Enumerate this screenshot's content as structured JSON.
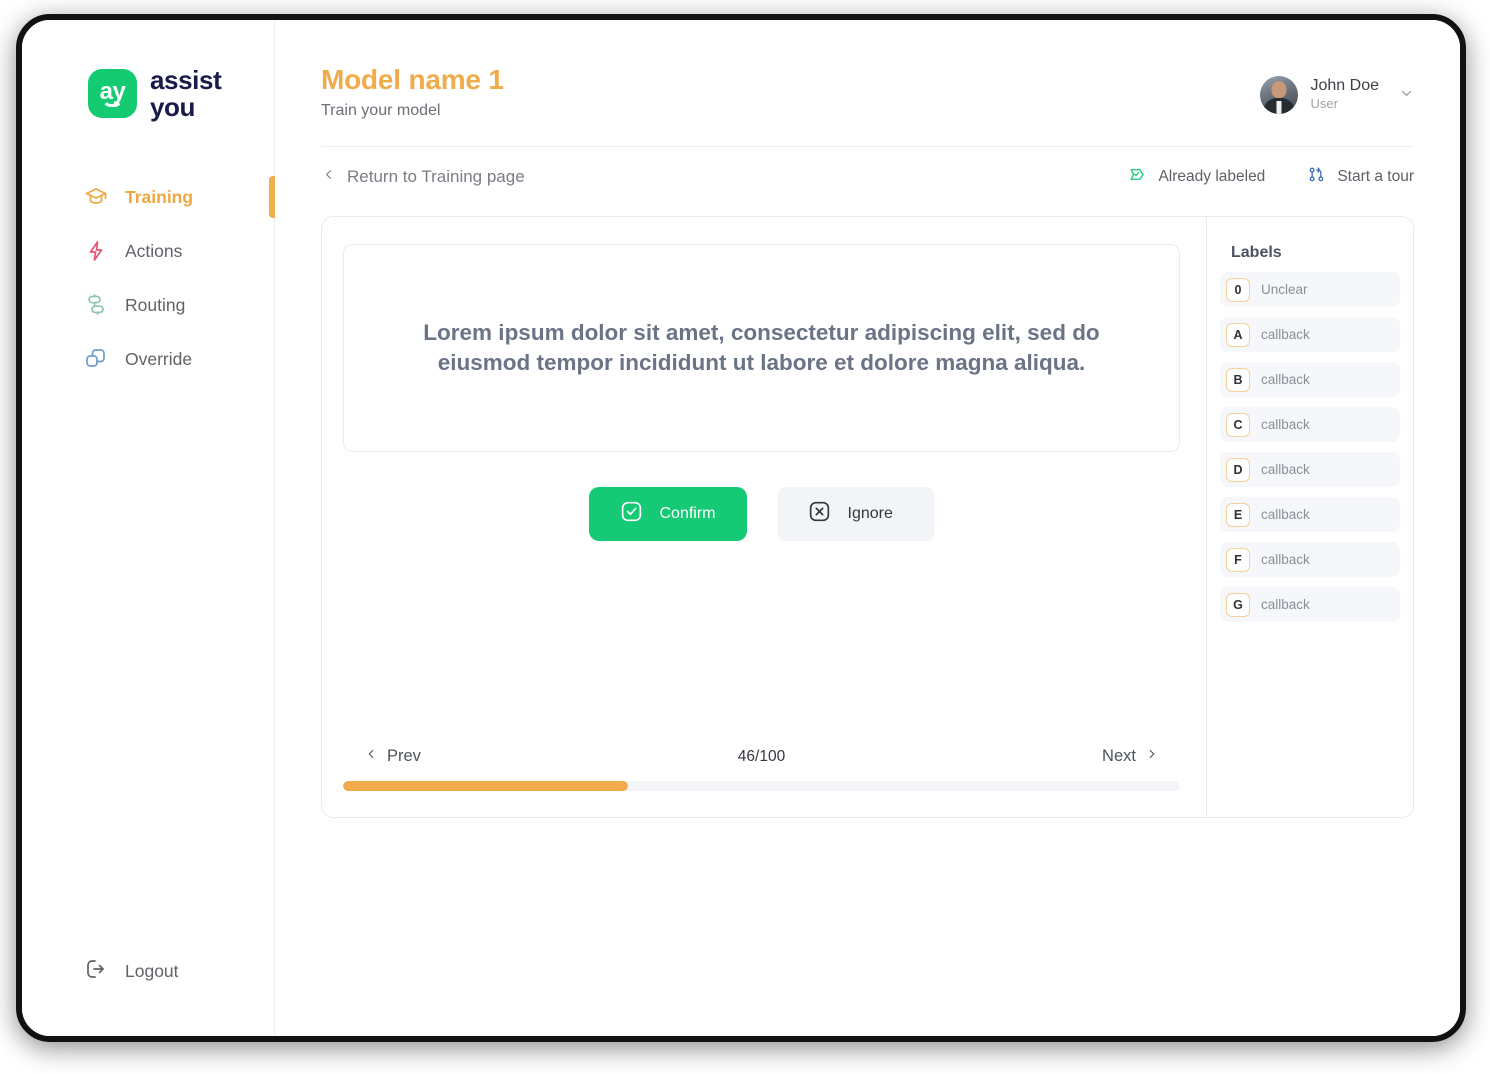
{
  "brand": {
    "logo_mark_text": "ay",
    "logo_line1": "assist",
    "logo_line2": "you",
    "green": "#15cb72",
    "navy": "#1b1b4b"
  },
  "sidebar": {
    "items": [
      {
        "label": "Training",
        "icon": "graduation-cap-icon",
        "active": true
      },
      {
        "label": "Actions",
        "icon": "lightning-bolt-icon",
        "active": false
      },
      {
        "label": "Routing",
        "icon": "routing-nodes-icon",
        "active": false
      },
      {
        "label": "Override",
        "icon": "overlapping-squares-icon",
        "active": false
      }
    ],
    "logout": {
      "label": "Logout",
      "icon": "logout-icon"
    }
  },
  "header": {
    "title": "Model name 1",
    "subtitle": "Train your model",
    "title_color": "#f0ab4b",
    "user": {
      "name": "John Doe",
      "role": "User",
      "avatar": "user-avatar-photo",
      "chevron": "chevron-down-icon"
    }
  },
  "subbar": {
    "back_label": "Return to Training page",
    "back_icon": "chevron-left-icon",
    "already_labeled": {
      "label": "Already labeled",
      "icon": "tag-check-icon",
      "color": "#16c975"
    },
    "start_tour": {
      "label": "Start a tour",
      "icon": "git-branch-icon",
      "color": "#3f6fb5"
    }
  },
  "main": {
    "sample_text": "Lorem ipsum dolor sit amet, consectetur adipiscing elit, sed do eiusmod tempor incididunt ut labore et dolore magna aliqua.",
    "confirm": {
      "label": "Confirm",
      "icon": "check-square-icon",
      "bg": "#16c975"
    },
    "ignore": {
      "label": "Ignore",
      "icon": "x-square-icon",
      "bg": "#f3f4f7"
    },
    "pager": {
      "prev_label": "Prev",
      "prev_icon": "chevron-left-icon",
      "next_label": "Next",
      "next_icon": "chevron-right-icon",
      "count": "46/100",
      "progress_percent": 34,
      "progress_color": "#f2ab4b"
    }
  },
  "labels_panel": {
    "title": "Labels",
    "items": [
      {
        "key": "0",
        "label": "Unclear"
      },
      {
        "key": "A",
        "label": "callback"
      },
      {
        "key": "B",
        "label": "callback"
      },
      {
        "key": "C",
        "label": "callback"
      },
      {
        "key": "D",
        "label": "callback"
      },
      {
        "key": "E",
        "label": "callback"
      },
      {
        "key": "F",
        "label": "callback"
      },
      {
        "key": "G",
        "label": "callback"
      }
    ]
  }
}
